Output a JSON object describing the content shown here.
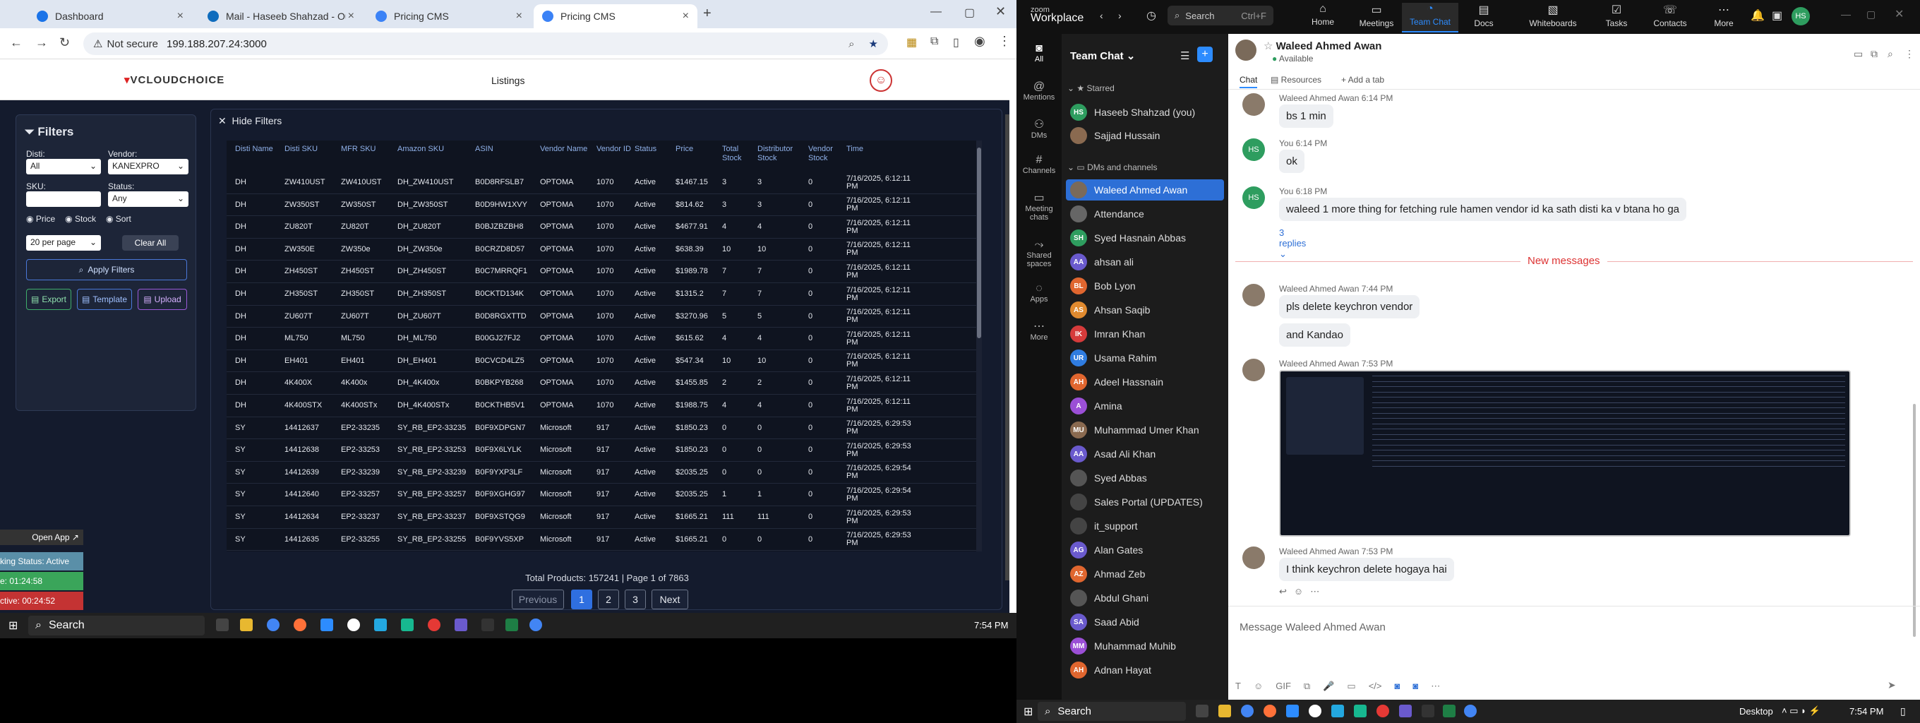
{
  "browser": {
    "tabs": [
      {
        "title": "Dashboard",
        "color": "#1a73e8"
      },
      {
        "title": "Mail - Haseeb Shahzad - Outlo",
        "color": "#0f6cbd"
      },
      {
        "title": "Pricing CMS",
        "color": "#3b82f6"
      },
      {
        "title": "Pricing CMS",
        "color": "#3b82f6"
      }
    ],
    "security": "Not secure",
    "url": "199.188.207.24:3000"
  },
  "app": {
    "logo": "VCLOUDCHOICE",
    "nav": "Listings",
    "hide_filters": "Hide Filters",
    "filters": {
      "title": "Filters",
      "disti_label": "Disti:",
      "disti_value": "All",
      "vendor_label": "Vendor:",
      "vendor_value": "KANEXPRO",
      "sku_label": "SKU:",
      "status_label": "Status:",
      "status_value": "Any",
      "radio_price": "Price",
      "radio_stock": "Stock",
      "radio_sort": "Sort",
      "per_page": "20 per page",
      "clear": "Clear All",
      "apply": "Apply Filters",
      "export": "Export",
      "template": "Template",
      "upload": "Upload"
    },
    "columns": [
      "Disti Name",
      "Disti SKU",
      "MFR SKU",
      "Amazon SKU",
      "ASIN",
      "Vendor Name",
      "Vendor ID",
      "Status",
      "Price",
      "Total Stock",
      "Distributor Stock",
      "Vendor Stock",
      "Time"
    ],
    "rows": [
      [
        "DH",
        "ZW410UST",
        "ZW410UST",
        "DH_ZW410UST",
        "B0D8RFSLB7",
        "OPTOMA",
        "1070",
        "Active",
        "$1467.15",
        "3",
        "3",
        "0",
        "7/16/2025, 6:12:11 PM"
      ],
      [
        "DH",
        "ZW350ST",
        "ZW350ST",
        "DH_ZW350ST",
        "B0D9HW1XVY",
        "OPTOMA",
        "1070",
        "Active",
        "$814.62",
        "3",
        "3",
        "0",
        "7/16/2025, 6:12:11 PM"
      ],
      [
        "DH",
        "ZU820T",
        "ZU820T",
        "DH_ZU820T",
        "B0BJZBZBH8",
        "OPTOMA",
        "1070",
        "Active",
        "$4677.91",
        "4",
        "4",
        "0",
        "7/16/2025, 6:12:11 PM"
      ],
      [
        "DH",
        "ZW350E",
        "ZW350e",
        "DH_ZW350e",
        "B0CRZD8D57",
        "OPTOMA",
        "1070",
        "Active",
        "$638.39",
        "10",
        "10",
        "0",
        "7/16/2025, 6:12:11 PM"
      ],
      [
        "DH",
        "ZH450ST",
        "ZH450ST",
        "DH_ZH450ST",
        "B0C7MRRQF1",
        "OPTOMA",
        "1070",
        "Active",
        "$1989.78",
        "7",
        "7",
        "0",
        "7/16/2025, 6:12:11 PM"
      ],
      [
        "DH",
        "ZH350ST",
        "ZH350ST",
        "DH_ZH350ST",
        "B0CKTD134K",
        "OPTOMA",
        "1070",
        "Active",
        "$1315.2",
        "7",
        "7",
        "0",
        "7/16/2025, 6:12:11 PM"
      ],
      [
        "DH",
        "ZU607T",
        "ZU607T",
        "DH_ZU607T",
        "B0D8RGXTTD",
        "OPTOMA",
        "1070",
        "Active",
        "$3270.96",
        "5",
        "5",
        "0",
        "7/16/2025, 6:12:11 PM"
      ],
      [
        "DH",
        "ML750",
        "ML750",
        "DH_ML750",
        "B00GJ27FJ2",
        "OPTOMA",
        "1070",
        "Active",
        "$615.62",
        "4",
        "4",
        "0",
        "7/16/2025, 6:12:11 PM"
      ],
      [
        "DH",
        "EH401",
        "EH401",
        "DH_EH401",
        "B0CVCD4LZ5",
        "OPTOMA",
        "1070",
        "Active",
        "$547.34",
        "10",
        "10",
        "0",
        "7/16/2025, 6:12:11 PM"
      ],
      [
        "DH",
        "4K400X",
        "4K400x",
        "DH_4K400x",
        "B0BKPYB268",
        "OPTOMA",
        "1070",
        "Active",
        "$1455.85",
        "2",
        "2",
        "0",
        "7/16/2025, 6:12:11 PM"
      ],
      [
        "DH",
        "4K400STX",
        "4K400STx",
        "DH_4K400STx",
        "B0CKTHB5V1",
        "OPTOMA",
        "1070",
        "Active",
        "$1988.75",
        "4",
        "4",
        "0",
        "7/16/2025, 6:12:11 PM"
      ],
      [
        "SY",
        "14412637",
        "EP2-33235",
        "SY_RB_EP2-33235",
        "B0F9XDPGN7",
        "Microsoft",
        "917",
        "Active",
        "$1850.23",
        "0",
        "0",
        "0",
        "7/16/2025, 6:29:53 PM"
      ],
      [
        "SY",
        "14412638",
        "EP2-33253",
        "SY_RB_EP2-33253",
        "B0F9X6LYLK",
        "Microsoft",
        "917",
        "Active",
        "$1850.23",
        "0",
        "0",
        "0",
        "7/16/2025, 6:29:53 PM"
      ],
      [
        "SY",
        "14412639",
        "EP2-33239",
        "SY_RB_EP2-33239",
        "B0F9YXP3LF",
        "Microsoft",
        "917",
        "Active",
        "$2035.25",
        "0",
        "0",
        "0",
        "7/16/2025, 6:29:54 PM"
      ],
      [
        "SY",
        "14412640",
        "EP2-33257",
        "SY_RB_EP2-33257",
        "B0F9XGHG97",
        "Microsoft",
        "917",
        "Active",
        "$2035.25",
        "1",
        "1",
        "0",
        "7/16/2025, 6:29:54 PM"
      ],
      [
        "SY",
        "14412634",
        "EP2-33237",
        "SY_RB_EP2-33237",
        "B0F9XSTQG9",
        "Microsoft",
        "917",
        "Active",
        "$1665.21",
        "111",
        "111",
        "0",
        "7/16/2025, 6:29:53 PM"
      ],
      [
        "SY",
        "14412635",
        "EP2-33255",
        "SY_RB_EP2-33255",
        "B0F9YVS5XP",
        "Microsoft",
        "917",
        "Active",
        "$1665.21",
        "0",
        "0",
        "0",
        "7/16/2025, 6:29:53 PM"
      ]
    ],
    "total": "Total Products: 157241 | Page 1 of 7863",
    "pager": {
      "prev": "Previous",
      "p1": "1",
      "p2": "2",
      "p3": "3",
      "next": "Next"
    }
  },
  "overlay": {
    "open_app": "Open App ↗",
    "status": "king Status: Active",
    "active_time": "e: 01:24:58",
    "inactive_time": "ctive: 00:24:52"
  },
  "taskbar": {
    "search": "Search",
    "time_left": "7:54 PM",
    "time_right": "7:54 PM",
    "desktop": "Desktop"
  },
  "zoom": {
    "brand_top": "zoom",
    "brand": "Workplace",
    "search": "Search",
    "shortcut": "Ctrl+F",
    "tabs": [
      "Home",
      "Meetings",
      "Team Chat",
      "Docs",
      "Whiteboards",
      "Tasks",
      "Contacts",
      "More"
    ],
    "rail": [
      "All",
      "Mentions",
      "DMs",
      "Channels",
      "Meeting chats",
      "Shared spaces",
      "Apps",
      "More"
    ],
    "list_title": "Team Chat",
    "starred": "Starred",
    "dms_header": "DMs and channels",
    "starred_items": [
      {
        "name": "Haseeb Shahzad (you)",
        "initials": "HS",
        "color": "#2e9d5f"
      },
      {
        "name": "Sajjad Hussain",
        "initials": "",
        "color": "#8a6a50"
      }
    ],
    "contacts": [
      {
        "name": "Waleed Ahmed Awan",
        "initials": "",
        "color": "#7a6a5a"
      },
      {
        "name": "Attendance",
        "initials": "",
        "color": "#666666"
      },
      {
        "name": "Syed Hasnain Abbas",
        "initials": "SH",
        "color": "#2e9d5f"
      },
      {
        "name": "ahsan ali",
        "initials": "AA",
        "color": "#6a5acd"
      },
      {
        "name": "Bob Lyon",
        "initials": "BL",
        "color": "#e0662f"
      },
      {
        "name": "Ahsan Saqib",
        "initials": "AS",
        "color": "#e08a2f"
      },
      {
        "name": "Imran Khan",
        "initials": "IK",
        "color": "#d63b3b"
      },
      {
        "name": "Usama Rahim",
        "initials": "UR",
        "color": "#2f7ce0"
      },
      {
        "name": "Adeel Hassnain",
        "initials": "AH",
        "color": "#e0662f"
      },
      {
        "name": "Amina",
        "initials": "A",
        "color": "#9b4fd6"
      },
      {
        "name": "Muhammad Umer Khan",
        "initials": "MU",
        "color": "#8a6a50"
      },
      {
        "name": "Asad Ali Khan",
        "initials": "AA",
        "color": "#6a5acd"
      },
      {
        "name": "Syed Abbas",
        "initials": "",
        "color": "#555555"
      },
      {
        "name": "Sales Portal (UPDATES)",
        "initials": "",
        "color": "#444444"
      },
      {
        "name": "it_support",
        "initials": "",
        "color": "#444444"
      },
      {
        "name": "Alan Gates",
        "initials": "AG",
        "color": "#6a5acd"
      },
      {
        "name": "Ahmad Zeb",
        "initials": "AZ",
        "color": "#e0662f"
      },
      {
        "name": "Abdul Ghani",
        "initials": "",
        "color": "#555555"
      },
      {
        "name": "Saad Abid",
        "initials": "SA",
        "color": "#6a5acd"
      },
      {
        "name": "Muhammad Muhib",
        "initials": "MM",
        "color": "#9b4fd6"
      },
      {
        "name": "Adnan Hayat",
        "initials": "AH",
        "color": "#e0662f"
      }
    ],
    "chat": {
      "name": "Waleed Ahmed Awan",
      "presence": "Available",
      "tabs": [
        "Chat",
        "Resources",
        "+ Add a tab"
      ],
      "new_messages": "New messages",
      "replies": "3 replies",
      "messages": [
        {
          "meta": "Waleed Ahmed Awan 6:14 PM",
          "text": "bs 1 min"
        },
        {
          "meta": "You 6:14 PM",
          "text": "ok"
        },
        {
          "meta": "You 6:18 PM",
          "text": "waleed 1 more thing for fetching rule hamen vendor id ka sath disti ka v btana ho ga"
        },
        {
          "meta": "Waleed Ahmed Awan 7:44 PM",
          "text": "pls delete keychron vendor"
        },
        {
          "meta": "",
          "text": "and Kandao"
        },
        {
          "meta": "Waleed Ahmed Awan 7:53 PM",
          "text": ""
        },
        {
          "meta": "Waleed Ahmed Awan 7:53 PM",
          "text": "I think keychron delete hogaya hai"
        }
      ],
      "composer_placeholder": "Message Waleed Ahmed Awan",
      "you_initials": "HS"
    }
  }
}
